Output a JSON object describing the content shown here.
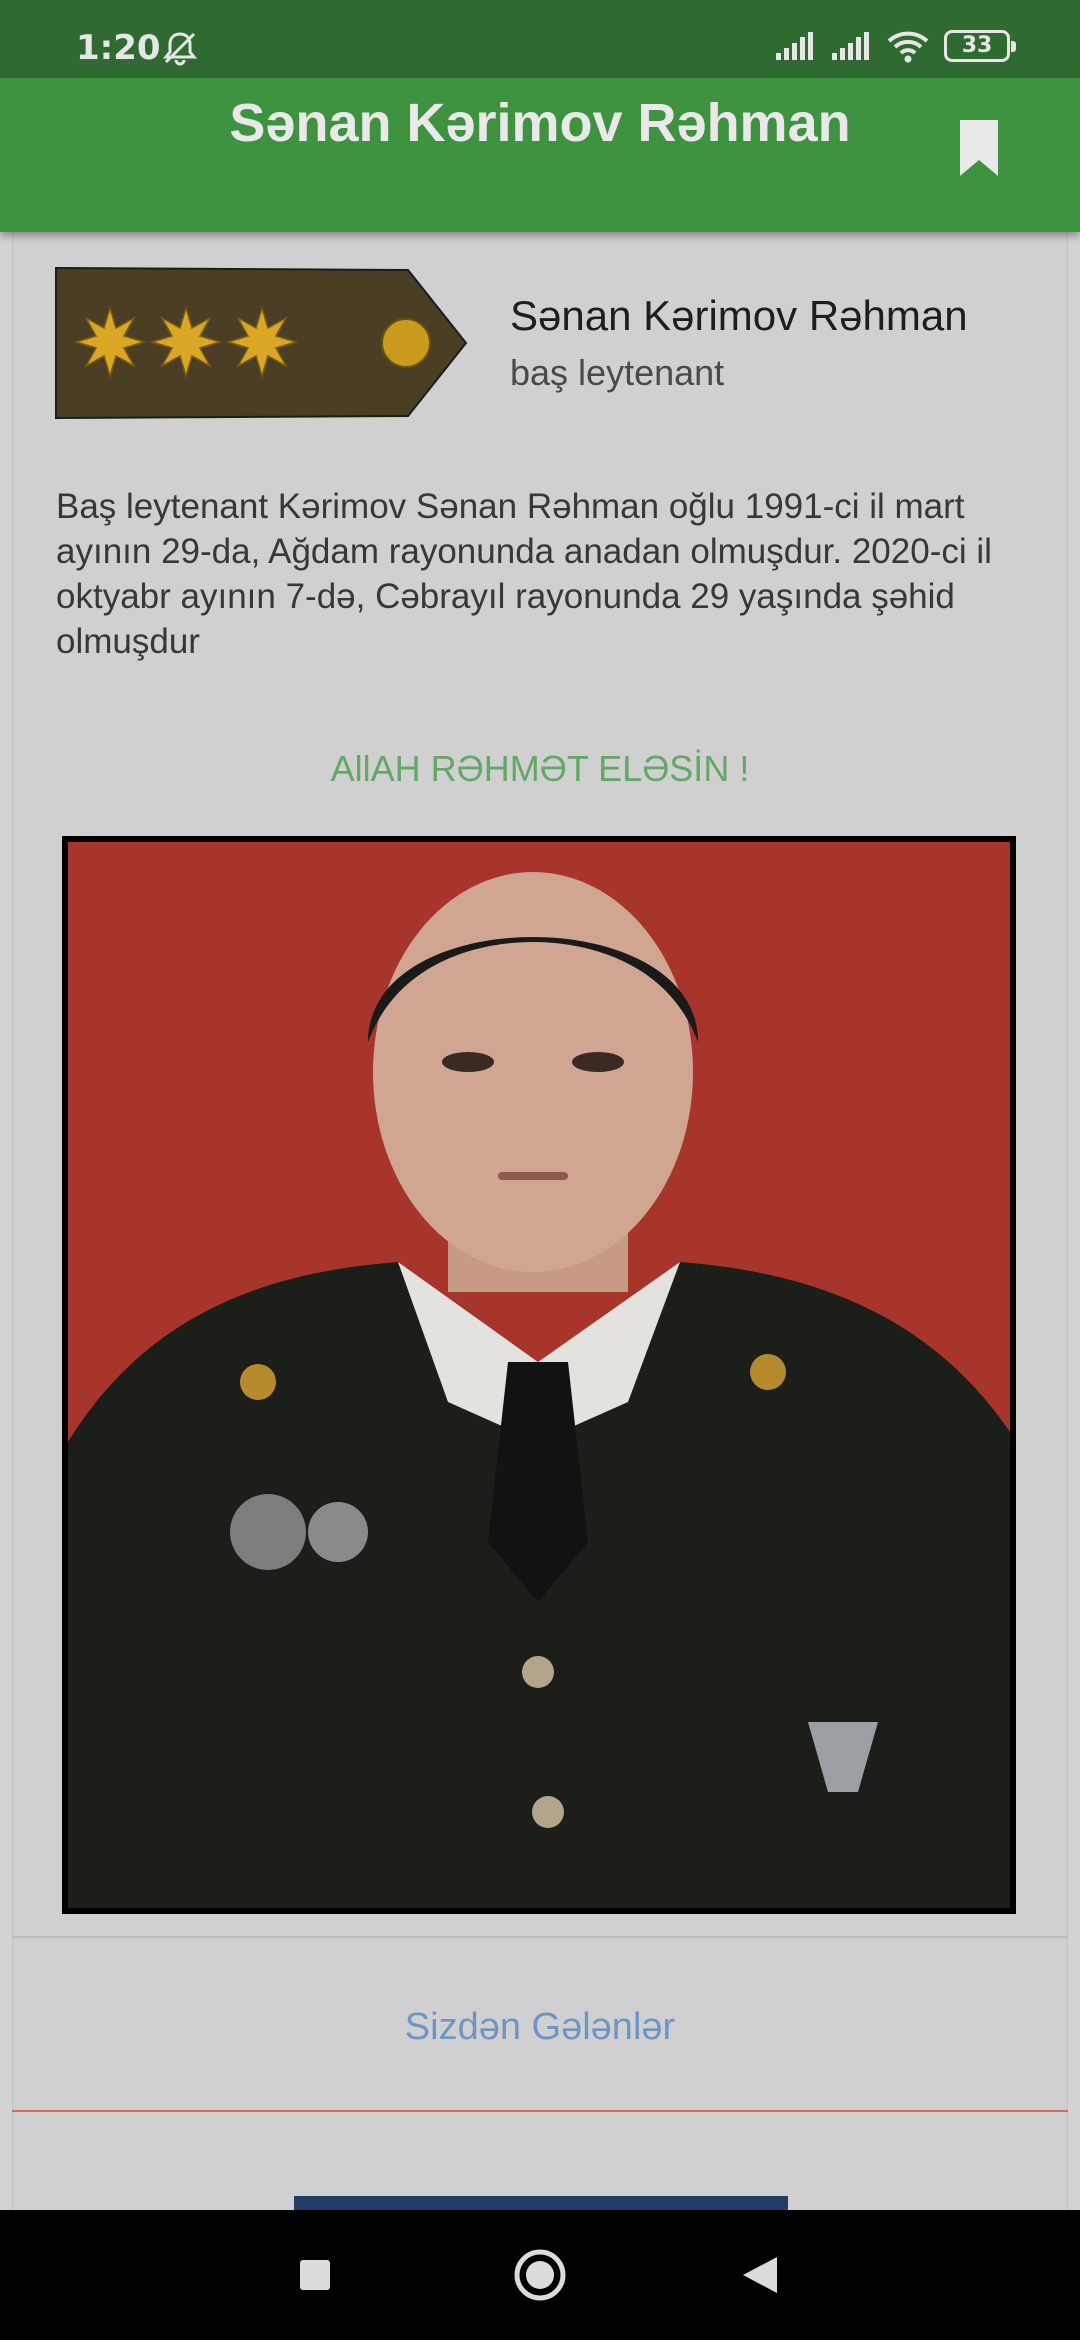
{
  "status_bar": {
    "time": "1:20",
    "battery": "33",
    "icons": [
      "bell-off-icon",
      "signal-icon",
      "signal-icon",
      "wifi-icon",
      "battery-icon"
    ]
  },
  "app_bar": {
    "title": "Sənan Kərimov Rəhman",
    "bookmark_icon": "bookmark-icon"
  },
  "profile": {
    "name": "Sənan Kərimov Rəhman",
    "rank": "baş leytenant",
    "insignia_icon": "senior-lieutenant-shoulder-board-icon",
    "bio": "Baş leytenant Kərimov Sənan Rəhman oğlu 1991-ci il mart ayının 29-da, Ağdam rayonunda  anadan olmuşdur. 2020-ci il oktyabr ayının 7-də, Cəbrayıl rayonunda 29 yaşında şəhid olmuşdur",
    "prayer": "AllAH RƏHMƏT ELƏSİN !"
  },
  "contributions": {
    "label": "Sizdən Gələnlər"
  },
  "nav_bar": {
    "icons": [
      "recents-square-icon",
      "home-circle-icon",
      "back-triangle-icon"
    ]
  },
  "colors": {
    "status_bar": "#2f6b31",
    "app_bar": "#3f923f",
    "prayer_text": "#63a864",
    "link_text": "#6f95c6",
    "divider_accent": "#d36a62"
  }
}
